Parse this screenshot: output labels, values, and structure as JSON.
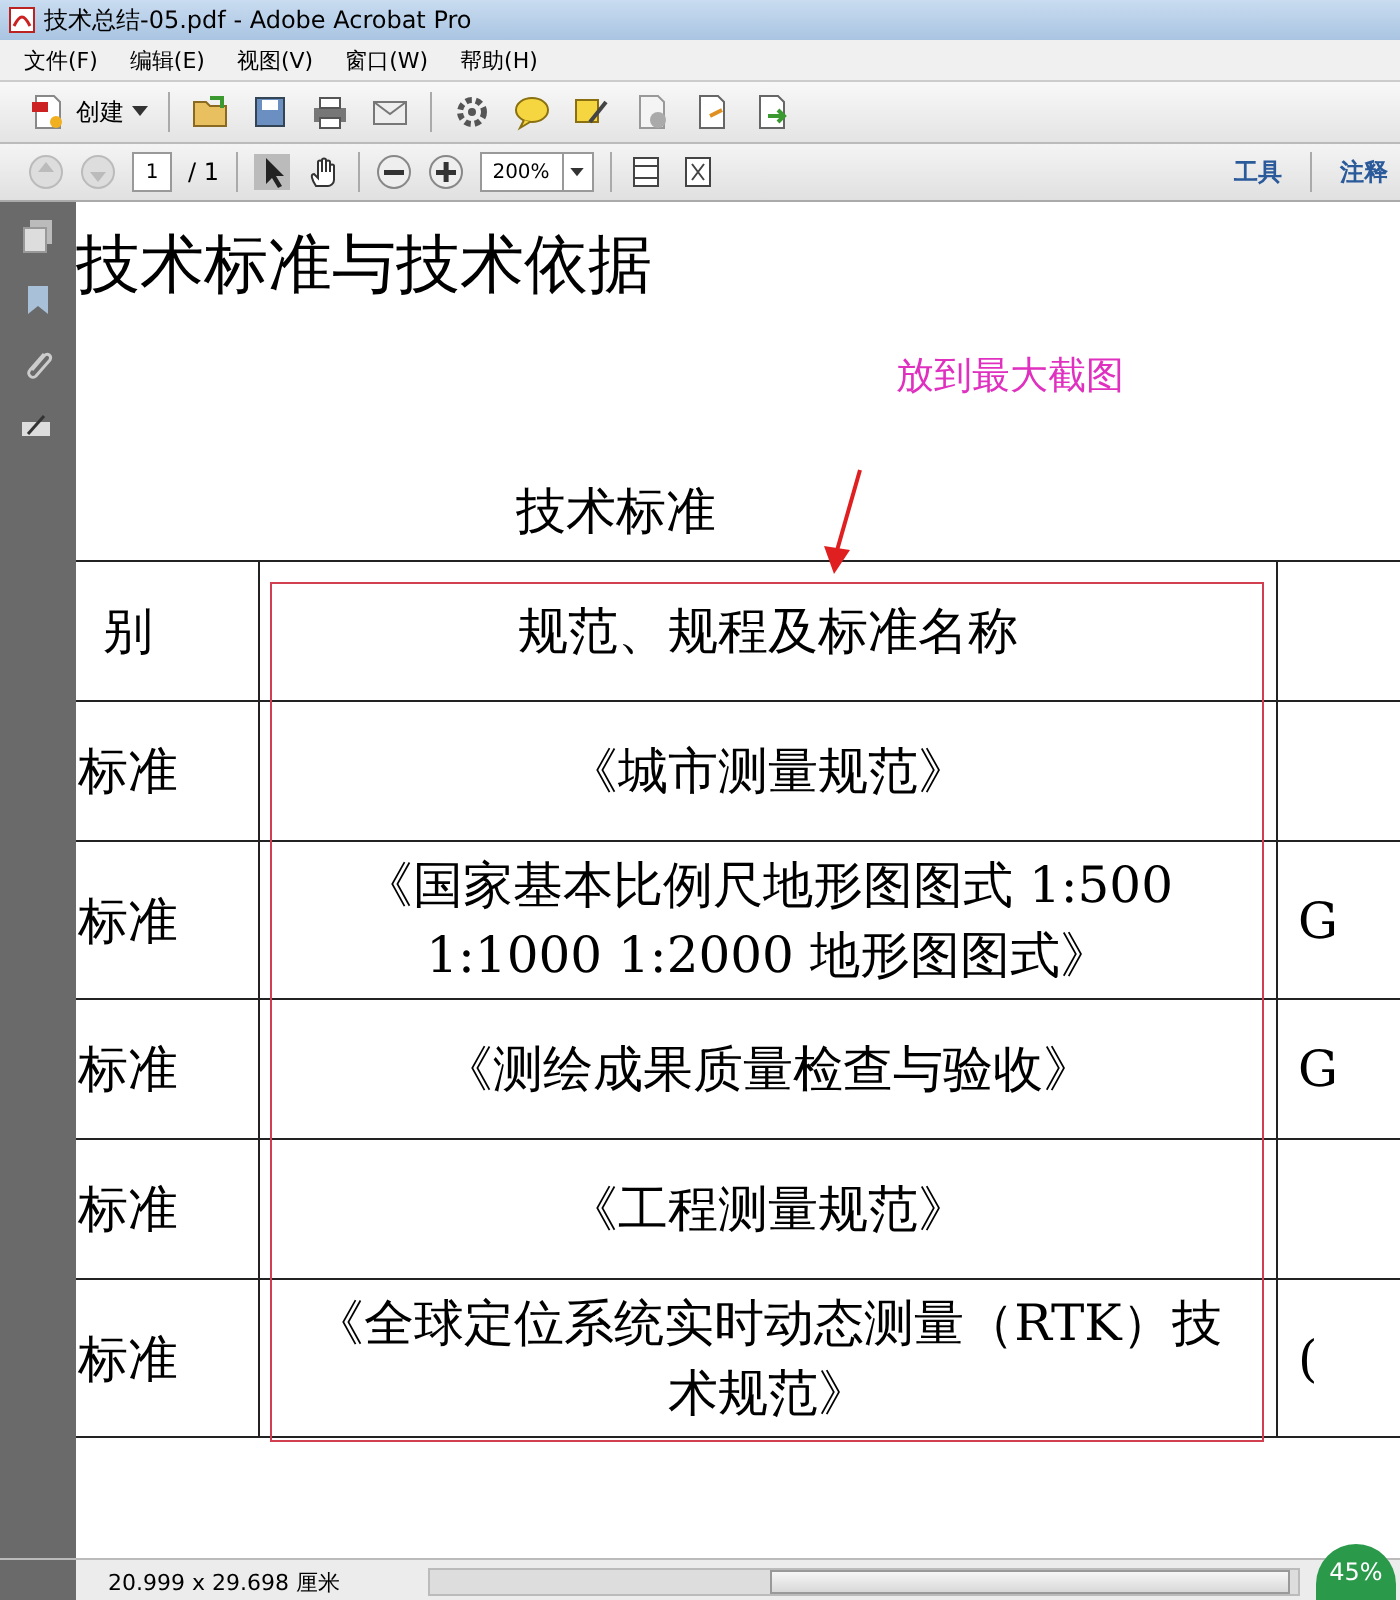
{
  "window": {
    "title": "技术总结-05.pdf - Adobe Acrobat Pro"
  },
  "menu": [
    "文件(F)",
    "编辑(E)",
    "视图(V)",
    "窗口(W)",
    "帮助(H)"
  ],
  "toolbar": {
    "create_label": "创建"
  },
  "nav": {
    "page": "1",
    "page_total": "/ 1",
    "zoom": "200%",
    "links": [
      "工具",
      "注释"
    ]
  },
  "document": {
    "heading": "技术标准与技术依据",
    "annotation": "放到最大截图",
    "table_title": "技术标准",
    "rows": [
      {
        "cells": [
          "别",
          "规范、规程及标准名称",
          ""
        ]
      },
      {
        "cells": [
          "标准",
          "《城市测量规范》",
          ""
        ]
      },
      {
        "cells": [
          "标准",
          "《国家基本比例尺地形图图式 1:500 1:1000 1:2000 地形图图式》",
          "G"
        ]
      },
      {
        "cells": [
          "标准",
          "《测绘成果质量检查与验收》",
          "G"
        ]
      },
      {
        "cells": [
          "标准",
          "《工程测量规范》",
          ""
        ]
      },
      {
        "cells": [
          "标准",
          "《全球定位系统实时动态测量（RTK）技术规范》",
          "("
        ]
      }
    ]
  },
  "status": {
    "page_size": "20.999 x 29.698 厘米",
    "badge": "45%"
  }
}
